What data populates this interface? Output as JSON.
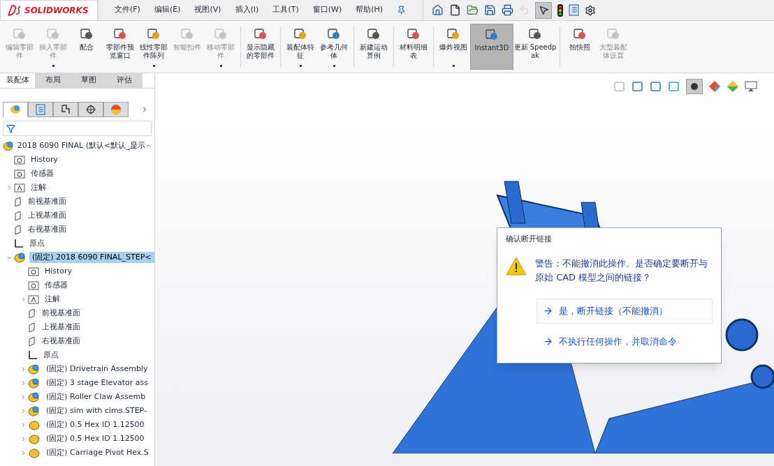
{
  "logo": {
    "brand": "SOLIDWORKS"
  },
  "menu": [
    "文件(F)",
    "编辑(E)",
    "视图(V)",
    "插入(I)",
    "工具(T)",
    "窗口(W)",
    "帮助(H)"
  ],
  "toolbar": {
    "select_tool_active": true,
    "undo_disabled": true
  },
  "ribbon": [
    {
      "label": "编辑零部件",
      "disabled": true,
      "dropdown": false,
      "selected": false,
      "divider_before": false
    },
    {
      "label": "插入零部件",
      "disabled": true,
      "dropdown": true,
      "selected": false,
      "divider_before": false
    },
    {
      "label": "配合",
      "disabled": false,
      "dropdown": false,
      "selected": false,
      "divider_before": false
    },
    {
      "label": "零部件预览窗口",
      "disabled": false,
      "dropdown": false,
      "selected": false,
      "divider_before": false
    },
    {
      "label": "线性零部件阵列",
      "disabled": false,
      "dropdown": true,
      "selected": false,
      "divider_before": false
    },
    {
      "label": "智能扣件",
      "disabled": true,
      "dropdown": false,
      "selected": false,
      "divider_before": false
    },
    {
      "label": "移动零部件",
      "disabled": true,
      "dropdown": true,
      "selected": false,
      "divider_before": false
    },
    {
      "label": "显示隐藏的零部件",
      "disabled": false,
      "dropdown": false,
      "selected": false,
      "divider_before": true
    },
    {
      "label": "装配体特征",
      "disabled": false,
      "dropdown": true,
      "selected": false,
      "divider_before": true
    },
    {
      "label": "参考几何体",
      "disabled": false,
      "dropdown": true,
      "selected": false,
      "divider_before": false
    },
    {
      "label": "新建运动算例",
      "disabled": false,
      "dropdown": false,
      "selected": false,
      "divider_before": true
    },
    {
      "label": "材料明细表",
      "disabled": false,
      "dropdown": false,
      "selected": false,
      "divider_before": true
    },
    {
      "label": "爆炸视图",
      "disabled": false,
      "dropdown": true,
      "selected": false,
      "divider_before": true
    },
    {
      "label": "Instant3D",
      "disabled": false,
      "dropdown": false,
      "selected": true,
      "divider_before": false
    },
    {
      "label": "更新 Speedpak",
      "disabled": false,
      "dropdown": false,
      "selected": false,
      "divider_before": false
    },
    {
      "label": "拍快照",
      "disabled": false,
      "dropdown": false,
      "selected": false,
      "divider_before": true
    },
    {
      "label": "大型装配体设置",
      "disabled": true,
      "dropdown": false,
      "selected": false,
      "divider_before": false
    }
  ],
  "tabs": [
    {
      "label": "装配体",
      "selected": true
    },
    {
      "label": "布局",
      "selected": false
    },
    {
      "label": "草图",
      "selected": false
    },
    {
      "label": "评估",
      "selected": false
    }
  ],
  "manager_tabs": [
    {
      "kind": "feature",
      "selected": true
    },
    {
      "kind": "property",
      "selected": false
    },
    {
      "kind": "config",
      "selected": false
    },
    {
      "kind": "dimxpert",
      "selected": false
    },
    {
      "kind": "display",
      "selected": false
    }
  ],
  "tree": {
    "label": "2018 6090 FINAL  (默认<默认_显示",
    "children": [
      {
        "kind": "history",
        "label": "History",
        "expandable": false,
        "selected": false
      },
      {
        "kind": "sensor",
        "label": "传感器",
        "expandable": false,
        "selected": false
      },
      {
        "kind": "annotation",
        "label": "注解",
        "expandable": true,
        "expanded": false,
        "selected": false
      },
      {
        "kind": "plane",
        "label": "前视基准面",
        "expandable": false,
        "selected": false
      },
      {
        "kind": "plane",
        "label": "上视基准面",
        "expandable": false,
        "selected": false
      },
      {
        "kind": "plane",
        "label": "右视基准面",
        "expandable": false,
        "selected": false
      },
      {
        "kind": "origin",
        "label": "原点",
        "expandable": false,
        "selected": false
      },
      {
        "kind": "assembly",
        "label": "(固定) 2018 6090 FINAL_STEP<",
        "expandable": true,
        "expanded": true,
        "selected": true,
        "children": [
          {
            "kind": "history",
            "label": "History",
            "expandable": false,
            "selected": false
          },
          {
            "kind": "sensor",
            "label": "传感器",
            "expandable": false,
            "selected": false
          },
          {
            "kind": "annotation",
            "label": "注解",
            "expandable": true,
            "expanded": false,
            "selected": false
          },
          {
            "kind": "plane",
            "label": "前视基准面",
            "expandable": false,
            "selected": false
          },
          {
            "kind": "plane",
            "label": "上视基准面",
            "expandable": false,
            "selected": false
          },
          {
            "kind": "plane",
            "label": "右视基准面",
            "expandable": false,
            "selected": false
          },
          {
            "kind": "origin",
            "label": "原点",
            "expandable": false,
            "selected": false
          },
          {
            "kind": "assembly",
            "label": "(固定) Drivetrain Assembly",
            "expandable": true,
            "expanded": false,
            "selected": false
          },
          {
            "kind": "assembly",
            "label": "(固定) 3 stage Elevator ass",
            "expandable": true,
            "expanded": false,
            "selected": false
          },
          {
            "kind": "assembly",
            "label": "(固定) Roller Claw Assemb",
            "expandable": true,
            "expanded": false,
            "selected": false
          },
          {
            "kind": "assembly",
            "label": "(固定) sim with cims.STEP-",
            "expandable": true,
            "expanded": false,
            "selected": false
          },
          {
            "kind": "part",
            "label": "(固定) 0.5 Hex ID 1.12500",
            "expandable": true,
            "expanded": false,
            "selected": false
          },
          {
            "kind": "part",
            "label": "(固定) 0.5 Hex ID 1.12500",
            "expandable": true,
            "expanded": false,
            "selected": false
          },
          {
            "kind": "part",
            "label": "(固定) Carriage Pivot Hex.S",
            "expandable": true,
            "expanded": false,
            "selected": false
          }
        ]
      }
    ]
  },
  "view_toolbar": {
    "display_active": true
  },
  "dialog": {
    "title": "确认断开链接",
    "message": "警告：不能撤消此操作。是否确定要断开与原始 CAD 模型之间的链接？",
    "options": [
      {
        "label": "是，断开链接（不能撤消）",
        "selected": true
      },
      {
        "label": "不执行任何操作，并取消命令",
        "selected": false
      }
    ]
  }
}
